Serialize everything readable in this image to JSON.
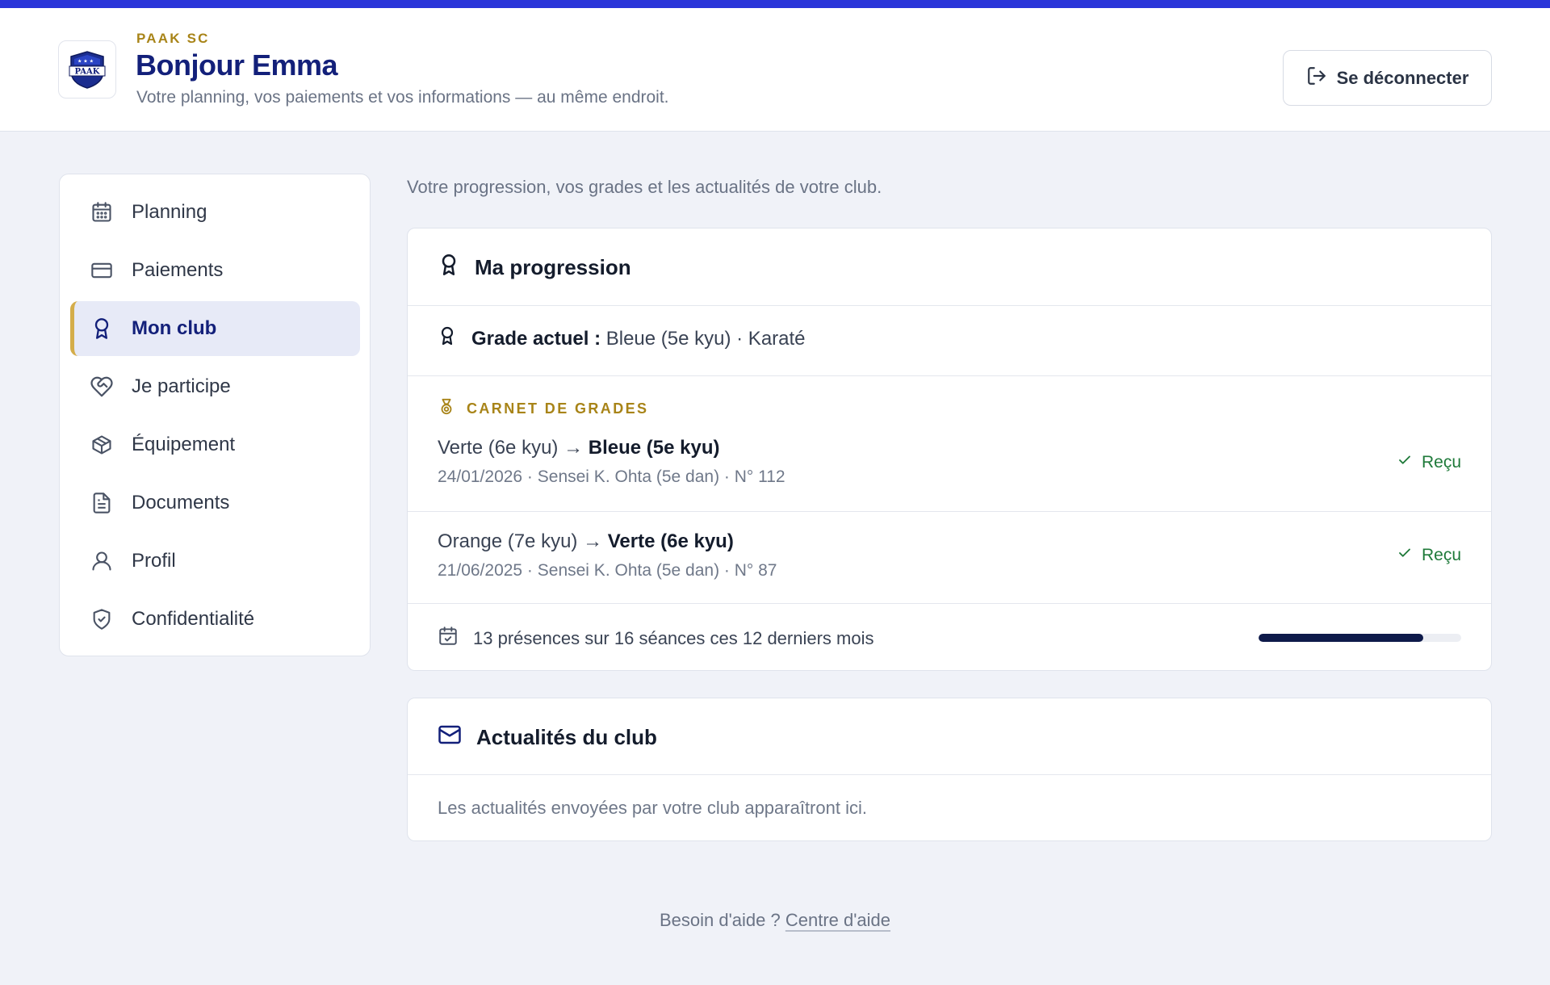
{
  "header": {
    "club_name": "PAAK SC",
    "greeting": "Bonjour Emma",
    "tagline": "Votre planning, vos paiements et vos informations — au même endroit.",
    "logo_text": "PAAK",
    "logout_label": "Se déconnecter"
  },
  "sidebar": {
    "items": [
      {
        "label": "Planning",
        "icon": "calendar-icon"
      },
      {
        "label": "Paiements",
        "icon": "credit-card-icon"
      },
      {
        "label": "Mon club",
        "icon": "award-icon",
        "active": true
      },
      {
        "label": "Je participe",
        "icon": "heart-handshake-icon"
      },
      {
        "label": "Équipement",
        "icon": "package-icon"
      },
      {
        "label": "Documents",
        "icon": "document-icon"
      },
      {
        "label": "Profil",
        "icon": "user-icon"
      },
      {
        "label": "Confidentialité",
        "icon": "shield-check-icon"
      }
    ]
  },
  "main": {
    "intro": "Votre progression, vos grades et les actualités de votre club.",
    "progression": {
      "title": "Ma progression",
      "current_grade_label": "Grade actuel :",
      "current_grade_value": "Bleue (5e kyu) · Karaté",
      "carnet_label": "CARNET DE GRADES",
      "grades": [
        {
          "from": "Verte (6e kyu) → ",
          "to": "Bleue (5e kyu)",
          "details": "24/01/2026 · Sensei K. Ohta (5e dan) · N° 112",
          "status": "Reçu"
        },
        {
          "from": "Orange (7e kyu) → ",
          "to": "Verte (6e kyu)",
          "details": "21/06/2025 · Sensei K. Ohta (5e dan) · N° 87",
          "status": "Reçu"
        }
      ],
      "attendance_text": "13 présences sur 16 séances ces 12 derniers mois",
      "attendance_fraction": 0.8125
    },
    "news": {
      "title": "Actualités du club",
      "empty_text": "Les actualités envoyées par votre club apparaîtront ici."
    }
  },
  "footer": {
    "help_text": "Besoin d'aide ?",
    "help_link": "Centre d'aide"
  },
  "colors": {
    "accent_bar": "#2a35d9",
    "brand_navy": "#13207a",
    "gold": "#a88418",
    "success": "#1f7a3a"
  }
}
